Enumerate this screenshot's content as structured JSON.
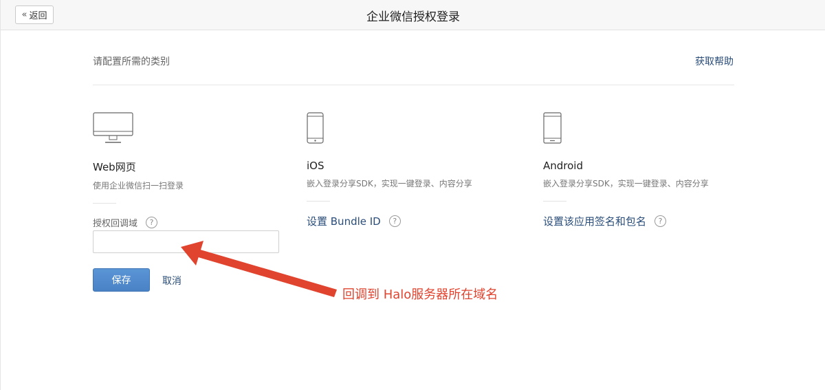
{
  "header": {
    "back_label": "返回",
    "title": "企业微信授权登录"
  },
  "section": {
    "heading": "请配置所需的类别",
    "help_link": "获取帮助"
  },
  "platforms": {
    "web": {
      "title": "Web网页",
      "description": "使用企业微信扫一扫登录",
      "field_label": "授权回调域",
      "input_value": "",
      "save_label": "保存",
      "cancel_label": "取消"
    },
    "ios": {
      "title": "iOS",
      "description": "嵌入登录分享SDK，实现一键登录、内容分享",
      "action_label": "设置 Bundle ID"
    },
    "android": {
      "title": "Android",
      "description": "嵌入登录分享SDK，实现一键登录、内容分享",
      "action_label": "设置该应用签名和包名"
    }
  },
  "help_icon_glyph": "?",
  "annotation": {
    "text": "回调到 Halo服务器所在域名",
    "color": "#e0432e"
  },
  "colors": {
    "link": "#2a4d7a",
    "primary_button": "#4a82c6"
  }
}
